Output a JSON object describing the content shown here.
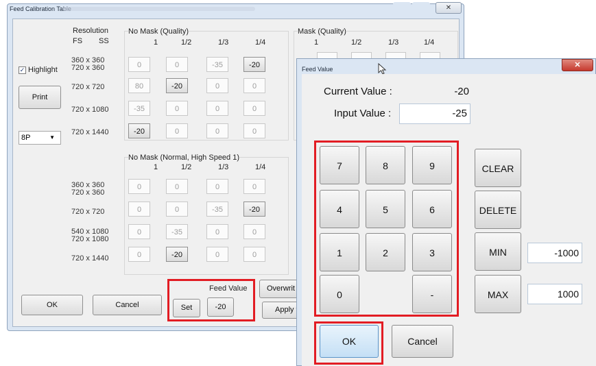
{
  "main_window": {
    "title": "Feed Calibration Table",
    "close_label": "✕",
    "headers": {
      "resolution": "Resolution",
      "fs": "FS",
      "ss": "SS",
      "no_mask_quality": "No Mask (Quality)",
      "mask_quality": "Mask (Quality)",
      "no_mask_normal": "No Mask (Normal, High Speed 1)",
      "cols": [
        "1",
        "1/2",
        "1/3",
        "1/4"
      ]
    },
    "highlight_label": "Highlight",
    "print_label": "Print",
    "mode_select": "8P",
    "resolutions_top": [
      [
        "360  x  360",
        "720  x  360"
      ],
      [
        "720  x  720"
      ],
      [
        "720  x  1080"
      ],
      [
        "720  x  1440"
      ]
    ],
    "resolutions_bottom": [
      [
        "360  x  360",
        "720  x  360"
      ],
      [
        "720  x  720"
      ],
      [
        "540  x  1080",
        "720  x  1080"
      ],
      [
        "720  x  1440"
      ]
    ],
    "table_top": [
      [
        "0",
        "0",
        "-35",
        "-20"
      ],
      [
        "80",
        "-20",
        "0",
        "0"
      ],
      [
        "-35",
        "0",
        "0",
        "0"
      ],
      [
        "-20",
        "0",
        "0",
        "0"
      ]
    ],
    "table_bottom": [
      [
        "0",
        "0",
        "0",
        "0"
      ],
      [
        "0",
        "0",
        "-35",
        "-20"
      ],
      [
        "0",
        "-35",
        "0",
        "0"
      ],
      [
        "0",
        "-20",
        "0",
        "0"
      ]
    ],
    "feed_value_label": "Feed Value",
    "feed_value": "-20",
    "set_label": "Set",
    "overwrite_label": "Overwrit",
    "apply_label": "Apply t",
    "ok_label": "OK",
    "cancel_label": "Cancel",
    "partial_value": "0"
  },
  "dialog": {
    "title": "Feed Value",
    "close_label": "✕",
    "current_value_label": "Current Value :",
    "current_value": "-20",
    "input_value_label": "Input Value :",
    "input_value": "-25",
    "keys": [
      "7",
      "8",
      "9",
      "4",
      "5",
      "6",
      "1",
      "2",
      "3",
      "0",
      "-"
    ],
    "clear_label": "CLEAR",
    "delete_label": "DELETE",
    "min_label": "MIN",
    "min_value": "-1000",
    "max_label": "MAX",
    "max_value": "1000",
    "ok_label": "OK",
    "cancel_label": "Cancel"
  },
  "colors": {
    "highlight_border": "#e21c23",
    "close_button": "#c63a2f",
    "window_frame": "#dbe6f3"
  }
}
